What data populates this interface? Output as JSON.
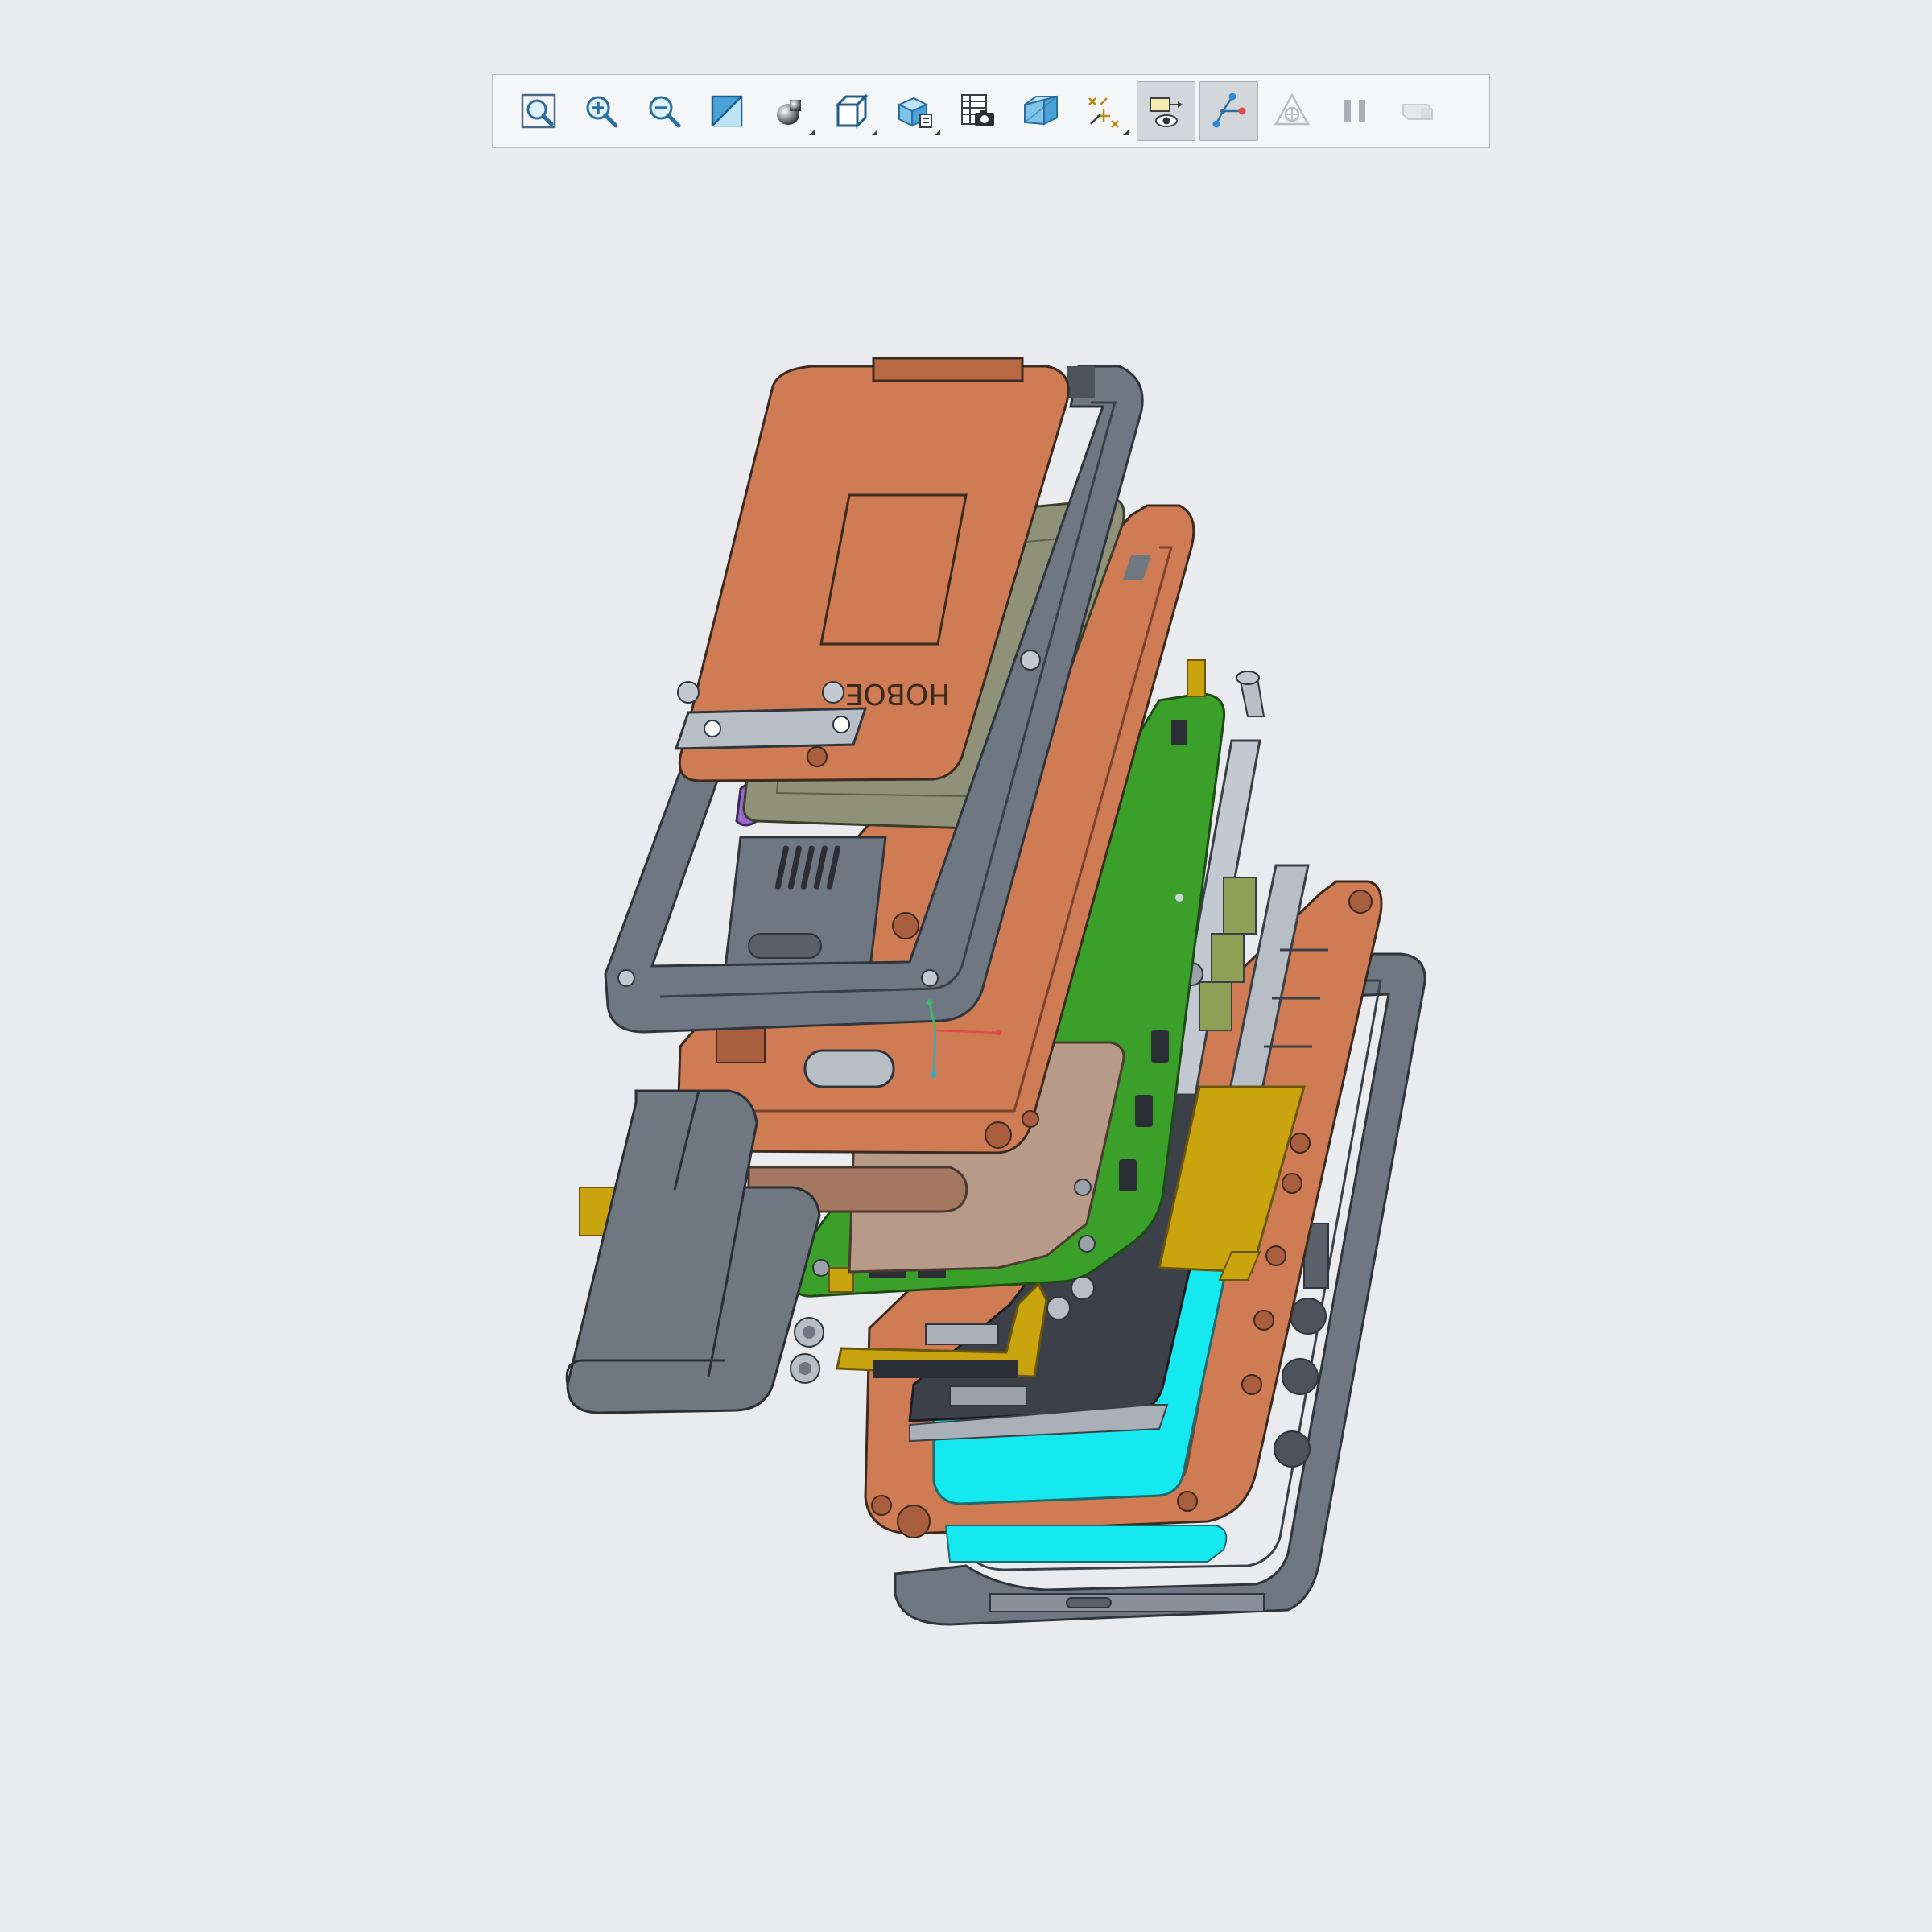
{
  "app": {
    "toolbar": {
      "buttons": [
        {
          "id": "refit",
          "icon": "zoom-fit-icon",
          "active": false,
          "flyout": false
        },
        {
          "id": "zoom-in",
          "icon": "zoom-in-icon",
          "active": false,
          "flyout": false
        },
        {
          "id": "zoom-out",
          "icon": "zoom-out-icon",
          "active": false,
          "flyout": false
        },
        {
          "id": "view-normal",
          "icon": "view-normal-icon",
          "active": false,
          "flyout": false
        },
        {
          "id": "shading",
          "icon": "shaded-sphere-icon",
          "active": false,
          "flyout": true
        },
        {
          "id": "display-style",
          "icon": "cube-display-style-icon",
          "active": false,
          "flyout": true
        },
        {
          "id": "saved-views",
          "icon": "saved-orientations-icon",
          "active": false,
          "flyout": true
        },
        {
          "id": "view-manager",
          "icon": "view-manager-camera-icon",
          "active": false,
          "flyout": false
        },
        {
          "id": "perspective",
          "icon": "perspective-view-icon",
          "active": false,
          "flyout": false
        },
        {
          "id": "datum-display",
          "icon": "datum-display-filters-icon",
          "active": false,
          "flyout": true
        },
        {
          "id": "annotation-display",
          "icon": "annotation-display-icon",
          "active": true,
          "flyout": false
        },
        {
          "id": "explode-offset",
          "icon": "exploded-offset-lines-icon",
          "active": true,
          "flyout": false
        },
        {
          "id": "spin-center",
          "icon": "spin-center-icon",
          "active": false,
          "flyout": false,
          "disabled": true
        },
        {
          "id": "pause",
          "icon": "pause-icon",
          "active": false,
          "flyout": false,
          "disabled": true
        },
        {
          "id": "hidden-line",
          "icon": "hidden-line-toggle-icon",
          "active": false,
          "flyout": false,
          "disabled": true
        }
      ]
    },
    "model": {
      "engraving": "HOBOE"
    },
    "colors": {
      "background": "#e9ebee",
      "copper": "#cf7c55",
      "frame_gray": "#6f7782",
      "pcb_green": "#3aa02a",
      "flex_gold": "#c9a40e",
      "lcd_cyan": "#16e8f0",
      "battery": "#6f7781",
      "display_olive": "#8f9278",
      "gasket_purple": "#9a68c8"
    }
  }
}
